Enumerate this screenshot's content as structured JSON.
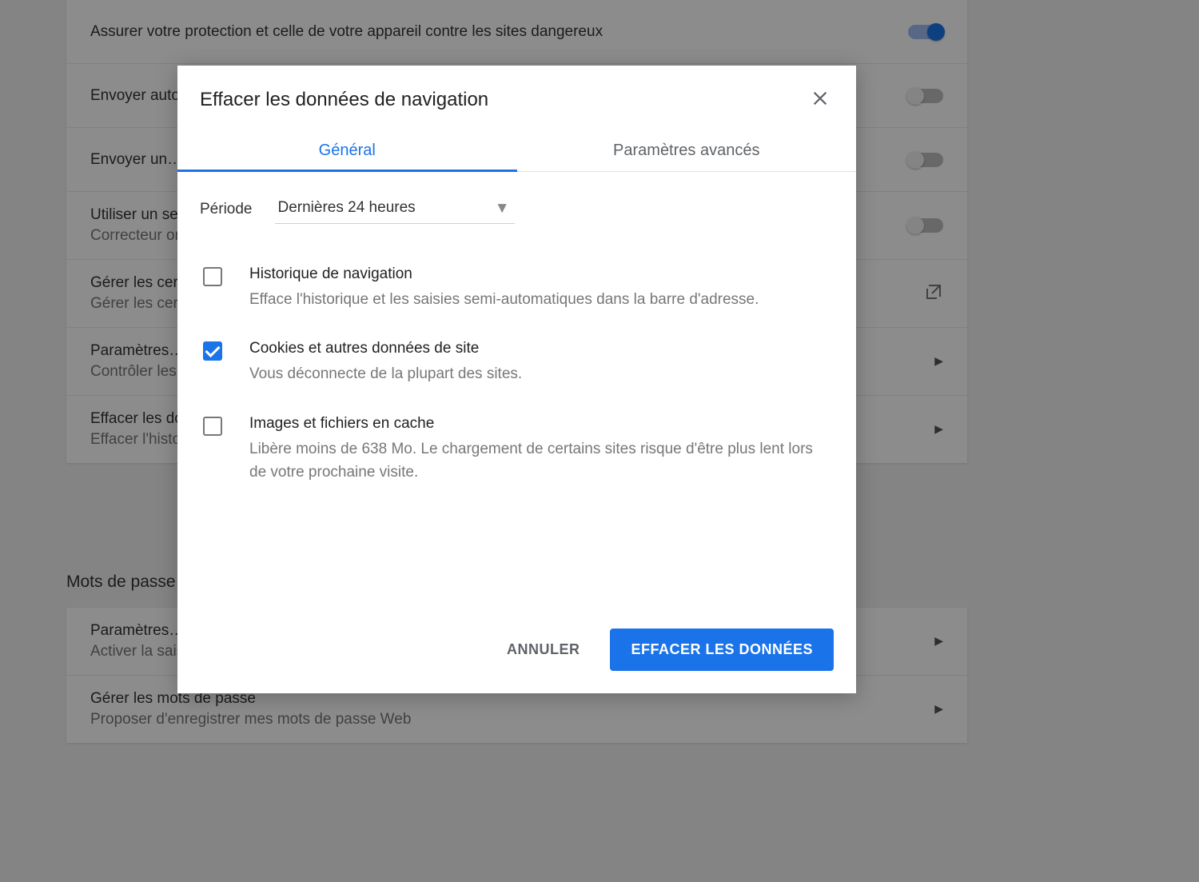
{
  "background": {
    "rows": [
      {
        "title": "Assurer votre protection et celle de votre appareil contre les sites dangereux",
        "sub": "",
        "control": "toggle-on"
      },
      {
        "title": "Envoyer automatiquement…",
        "sub": "",
        "control": "toggle-off"
      },
      {
        "title": "Envoyer un…",
        "sub": "",
        "control": "toggle-off"
      },
      {
        "title": "Utiliser un service…",
        "sub": "Correcteur orthographique … navigateur",
        "control": "toggle-off"
      },
      {
        "title": "Gérer les certificats",
        "sub": "Gérer les certificats",
        "control": "external"
      },
      {
        "title": "Paramètres…",
        "sub": "Contrôler les…",
        "control": "chevron"
      },
      {
        "title": "Effacer les données de navigation",
        "sub": "Effacer l'historique…",
        "control": "chevron"
      }
    ],
    "section_heading": "Mots de passe et formulaires",
    "rows2": [
      {
        "title": "Paramètres…",
        "sub": "Activer la saisie automatique…",
        "control": "chevron"
      },
      {
        "title": "Gérer les mots de passe",
        "sub": "Proposer d'enregistrer mes mots de passe Web",
        "control": "chevron"
      }
    ]
  },
  "dialog": {
    "title": "Effacer les données de navigation",
    "tabs": {
      "general": "Général",
      "advanced": "Paramètres avancés",
      "active": "general"
    },
    "period": {
      "label": "Période",
      "value": "Dernières 24 heures"
    },
    "items": [
      {
        "checked": false,
        "title": "Historique de navigation",
        "sub": "Efface l'historique et les saisies semi-automatiques dans la barre d'adresse."
      },
      {
        "checked": true,
        "title": "Cookies et autres données de site",
        "sub": "Vous déconnecte de la plupart des sites."
      },
      {
        "checked": false,
        "title": "Images et fichiers en cache",
        "sub": "Libère moins de 638 Mo. Le chargement de certains sites risque d'être plus lent lors de votre prochaine visite."
      }
    ],
    "buttons": {
      "cancel": "ANNULER",
      "confirm": "EFFACER LES DONNÉES"
    }
  }
}
